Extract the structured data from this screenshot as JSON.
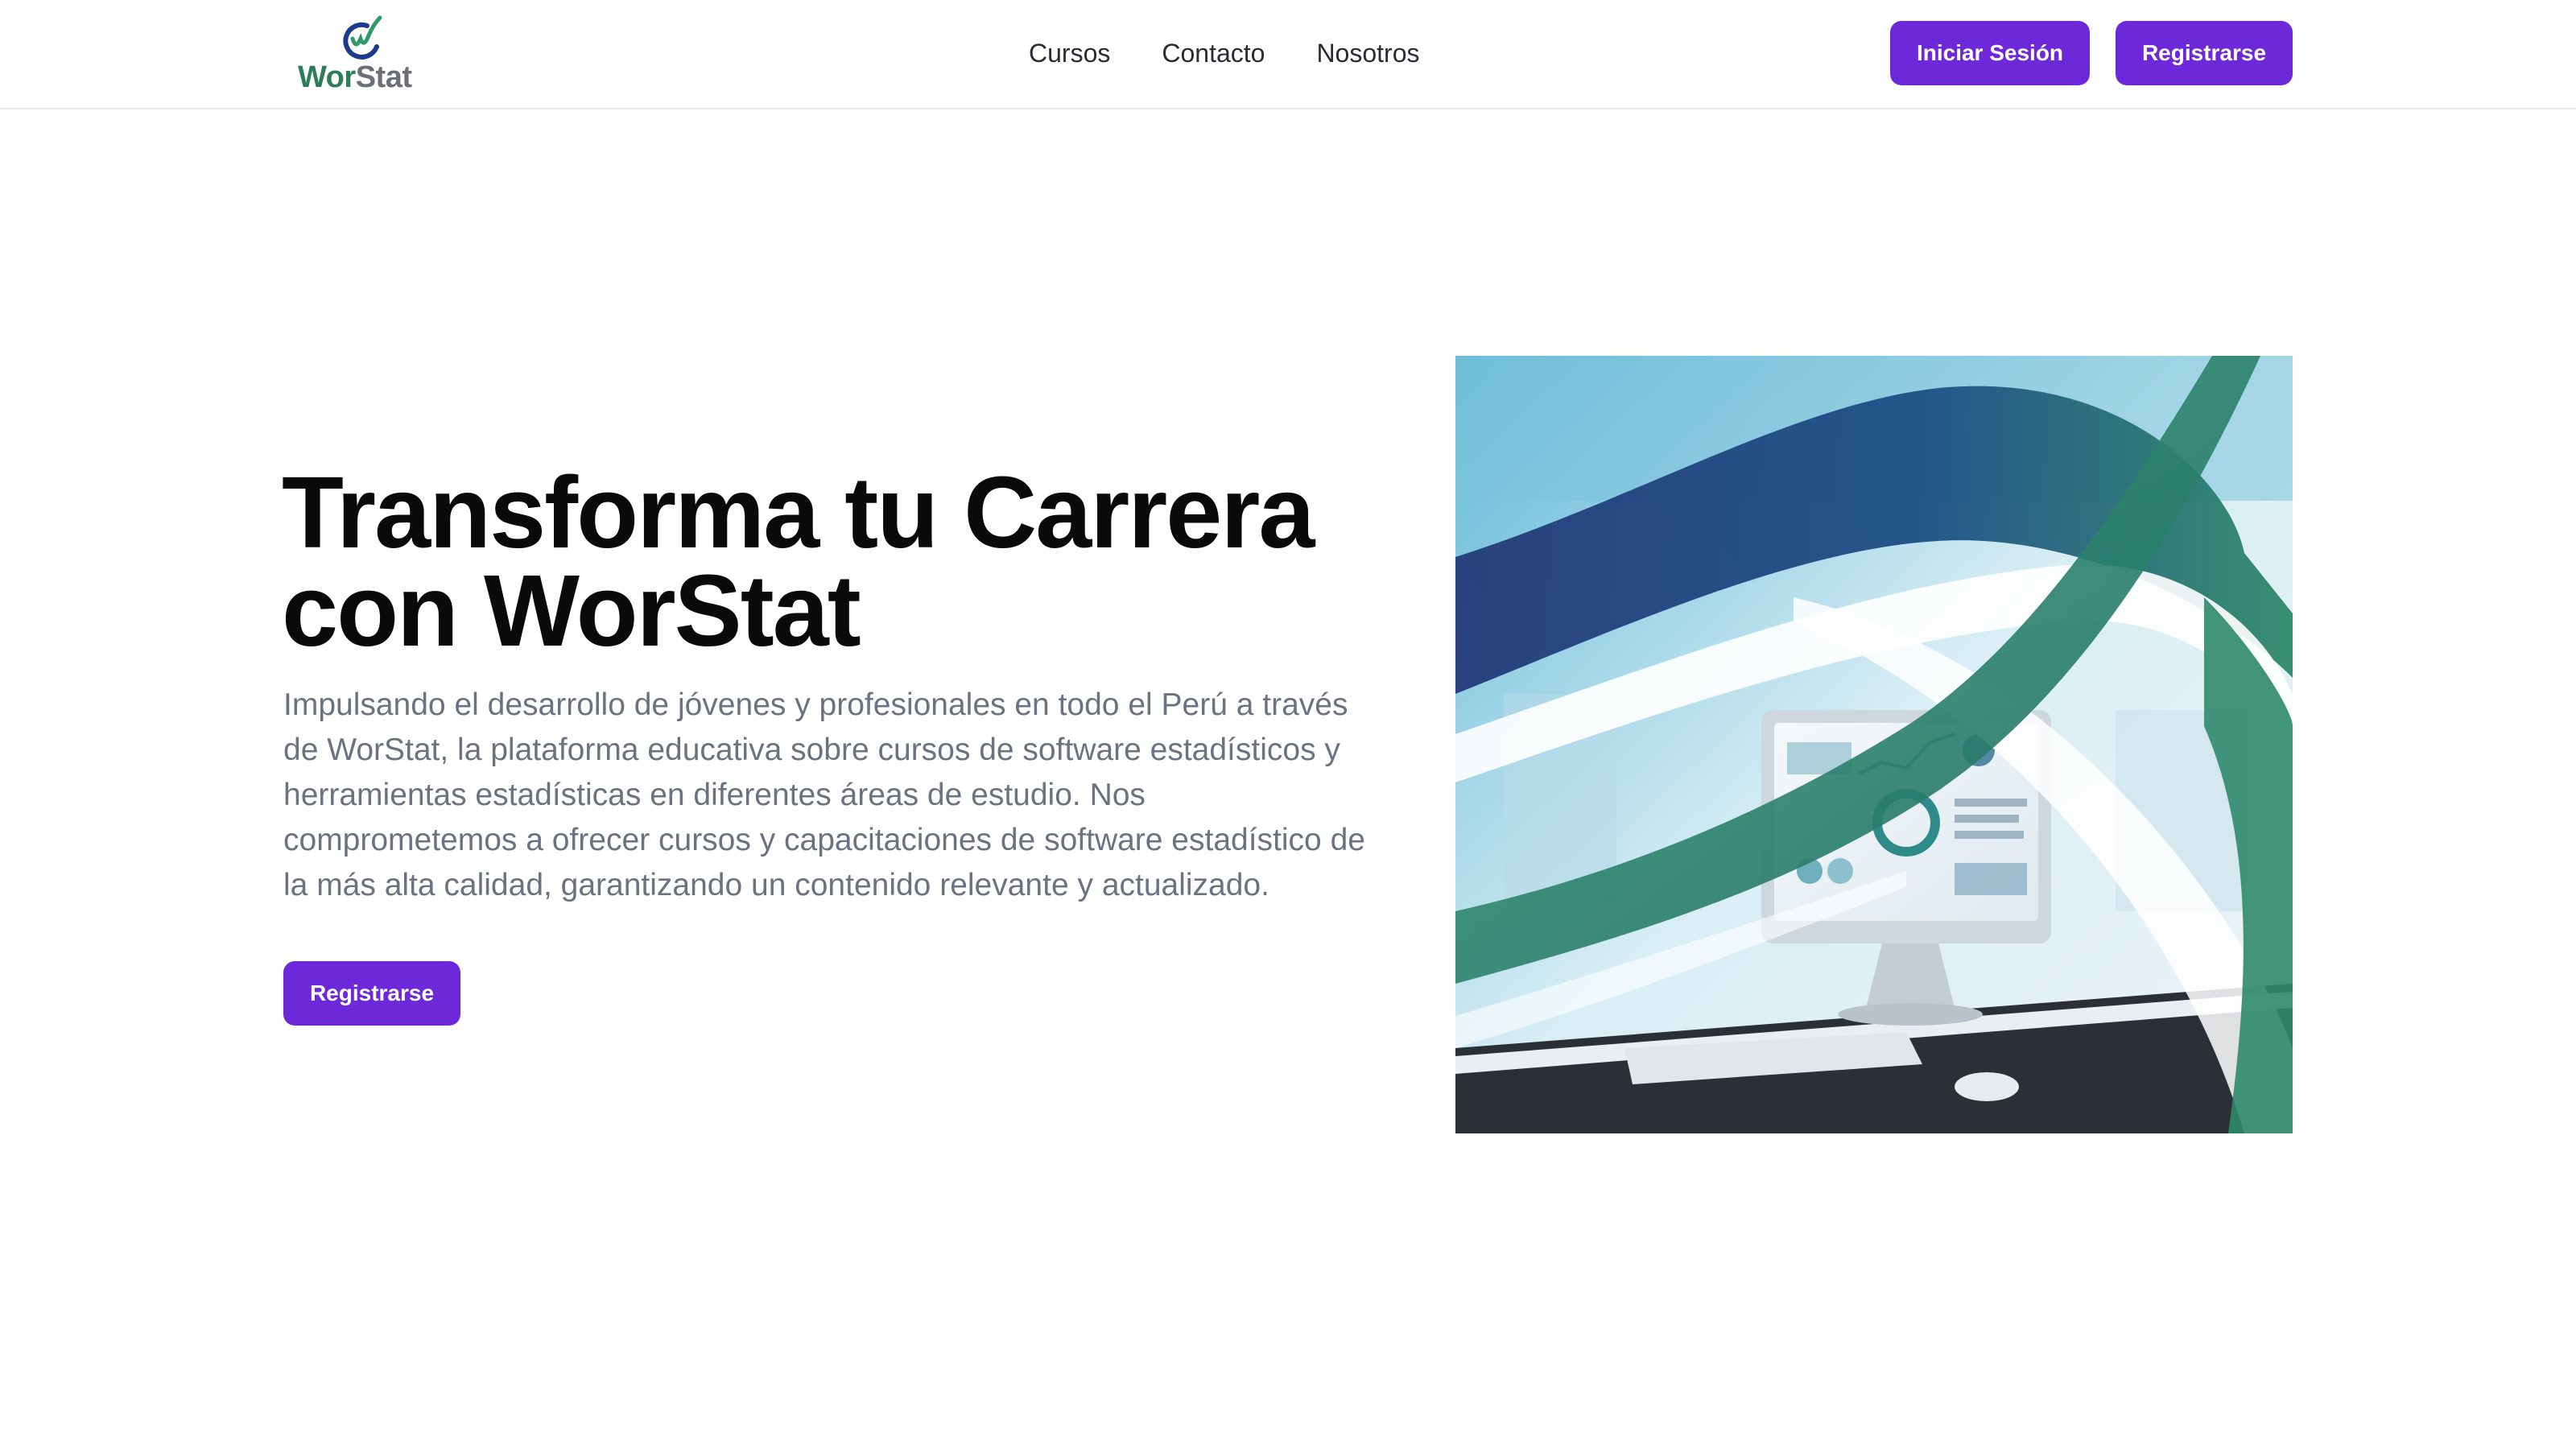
{
  "brand": {
    "name_part1": "Wor",
    "name_part2": "Stat",
    "logo_icon": "worstat-logo-icon",
    "colors": {
      "green": "#2e7d5a",
      "navy": "#1e3a8a",
      "gray": "#6b6f77"
    }
  },
  "nav": {
    "items": [
      {
        "label": "Cursos"
      },
      {
        "label": "Contacto"
      },
      {
        "label": "Nosotros"
      }
    ]
  },
  "header_actions": {
    "login_label": "Iniciar Sesión",
    "signup_label": "Registrarse"
  },
  "hero": {
    "title": "Transforma tu Carrera con WorStat",
    "description": "Impulsando el desarrollo de jóvenes y profesionales en todo el Perú a través de WorStat, la plataforma educativa sobre cursos de software estadísticos y herramientas estadísticas en diferentes áreas de estudio. Nos comprometemos a ofrecer cursos y capacitaciones de software estadístico de la más alta calidad, garantizando un contenido relevante y actualizado.",
    "cta_label": "Registrarse",
    "image_icon": "computer-dashboard-illustration"
  },
  "theme": {
    "accent": "#6d28d9",
    "title_color": "#0a0a0a",
    "text_color": "#6b7280"
  }
}
